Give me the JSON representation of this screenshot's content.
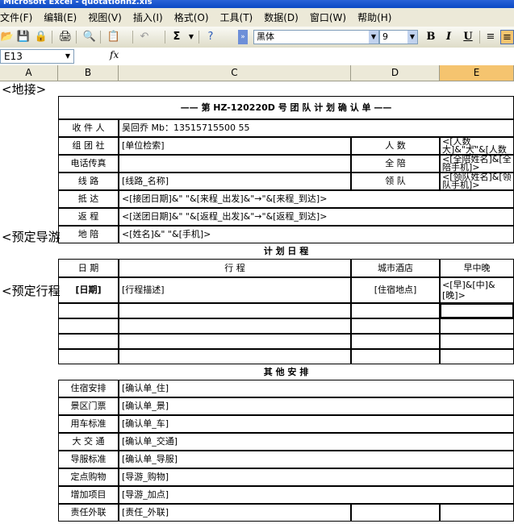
{
  "window": {
    "title": "Microsoft Excel - quotationhz.xls"
  },
  "menu": [
    "文件(F)",
    "编辑(E)",
    "视图(V)",
    "插入(I)",
    "格式(O)",
    "工具(T)",
    "数据(D)",
    "窗口(W)",
    "帮助(H)"
  ],
  "toolbar": {
    "font": "黑体",
    "size": "9",
    "sum": "Σ",
    "bold": "B",
    "italic": "I",
    "underline": "U"
  },
  "formula": {
    "name_box": "E13",
    "fx": "fx",
    "content": ""
  },
  "columns": [
    "A",
    "B",
    "C",
    "D",
    "E"
  ],
  "selected_column": "E",
  "side_labels": [
    "<地接>",
    "<预定导游",
    "<预定行程"
  ],
  "sheet": {
    "header": "—— 第 HZ-120220D 号 团 队 计 划 确 认 单 ——",
    "info": [
      {
        "label": "收 件 人",
        "value": "吴回乔  Mb：13515715500 55"
      },
      {
        "label": "组 团 社",
        "value": "[单位检索]",
        "right_label": "人  数",
        "right_value": "<[人数_大]&\"大\"&[人数_小]&\"小\">"
      },
      {
        "label": "电话传真",
        "value": "",
        "right_label": "全  陪",
        "right_value": "<[全陪姓名]&[全陪手机]>"
      },
      {
        "label": "线    路",
        "value": "[线路_名称]",
        "right_label": "领  队",
        "right_value": "<[领队姓名]&[领队手机]>"
      },
      {
        "label": "抵    达",
        "value": "<[接团日期]&\"  \"&[来程_出发]&\"→\"&[来程_到达]>"
      },
      {
        "label": "返    程",
        "value": "<[送团日期]&\"  \"&[返程_出发]&\"→\"&[返程_到达]>"
      },
      {
        "label": "地    陪",
        "value": "<[姓名]&\"  \"&[手机]>"
      }
    ],
    "plan_title": "计 划 日 程",
    "plan_headers": {
      "date": "日  期",
      "route": "行      程",
      "hotel": "城市酒店",
      "meals": "早中晚"
    },
    "plan_row": {
      "date": "[日期]",
      "route": "[行程描述]",
      "hotel": "[住宿地点]",
      "meals": "<[早]&[中]&[晚]>"
    },
    "other_title": "其 他 安 排",
    "other": [
      {
        "label": "住宿安排",
        "value": "[确认单_住]"
      },
      {
        "label": "景区门票",
        "value": "[确认单_景]"
      },
      {
        "label": "用车标准",
        "value": "[确认单_车]"
      },
      {
        "label": "大 交 通",
        "value": "[确认单_交通]"
      },
      {
        "label": "导服标准",
        "value": "[确认单_导服]"
      },
      {
        "label": "定点购物",
        "value": "[导游_购物]"
      },
      {
        "label": "增加项目",
        "value": "[导游_加点]"
      },
      {
        "label": "责任外联",
        "value": "[责任_外联]"
      }
    ]
  }
}
